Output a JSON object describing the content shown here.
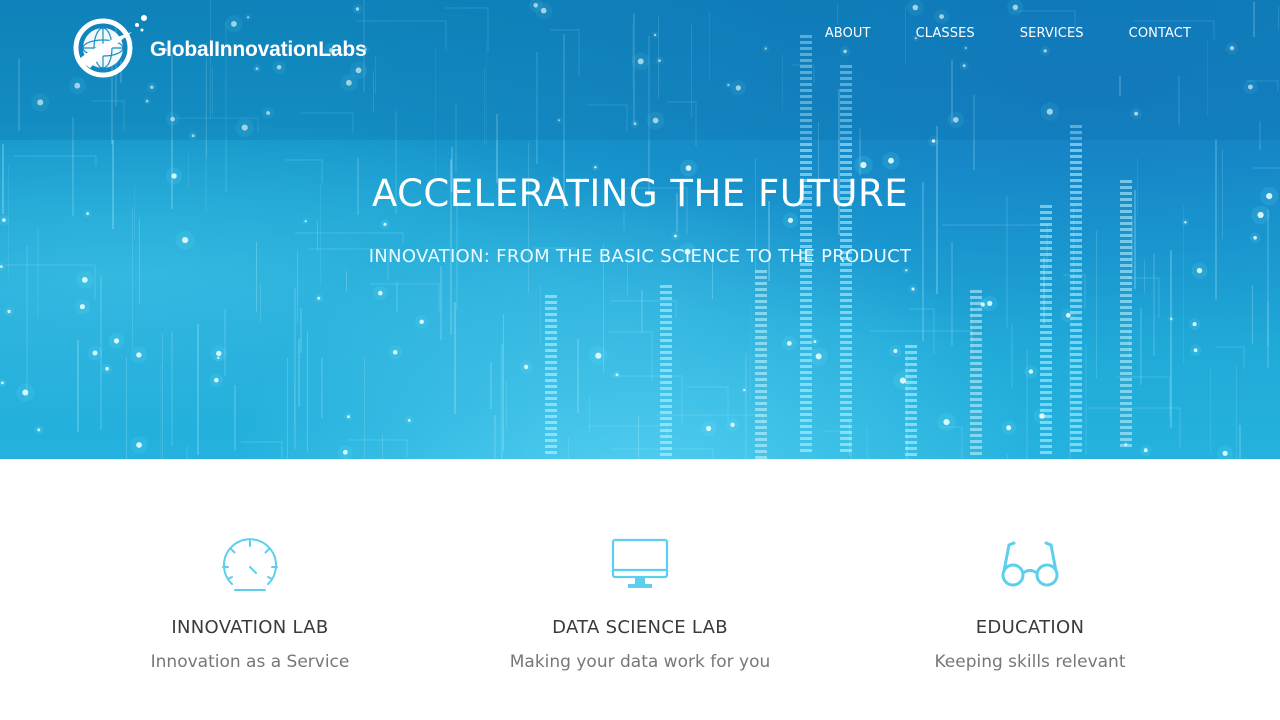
{
  "brand": {
    "name": "GlobalInnovationLabs",
    "logo_icon": "globe-swoosh-icon"
  },
  "nav": {
    "items": [
      {
        "label": "ABOUT"
      },
      {
        "label": "CLASSES"
      },
      {
        "label": "SERVICES"
      },
      {
        "label": "CONTACT"
      }
    ]
  },
  "hero": {
    "title": "ACCELERATING THE FUTURE",
    "subtitle": "INNOVATION: FROM THE BASIC SCIENCE TO THE PRODUCT"
  },
  "features": [
    {
      "icon": "speedometer-icon",
      "title": "INNOVATION LAB",
      "description": "Innovation as a Service"
    },
    {
      "icon": "monitor-icon",
      "title": "DATA SCIENCE LAB",
      "description": "Making your data work for you"
    },
    {
      "icon": "glasses-icon",
      "title": "EDUCATION",
      "description": "Keeping skills relevant"
    }
  ],
  "colors": {
    "accent": "#5ccfee",
    "hero_blue": "#1a9fd1",
    "heading_text": "#3a3a3a",
    "body_text": "#777777"
  }
}
